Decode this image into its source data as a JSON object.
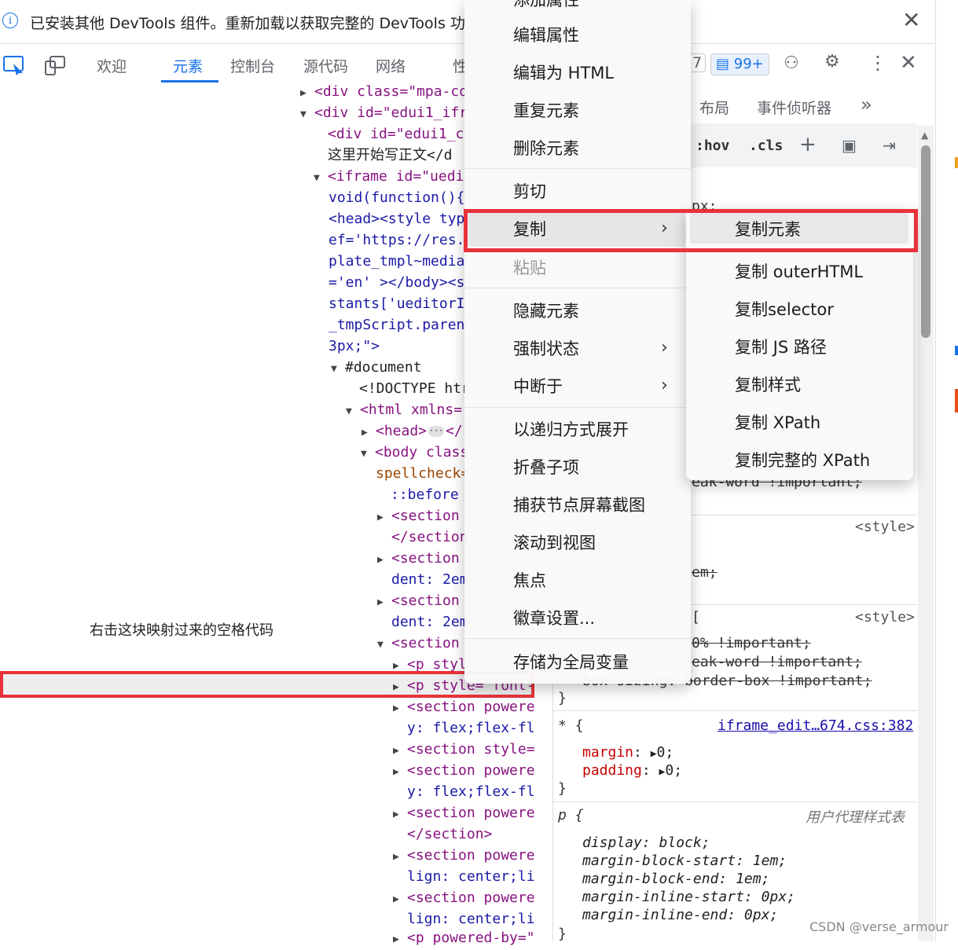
{
  "infobar": {
    "text": "已安装其他 DevTools 组件。重新加载以获取完整的 DevTools 功",
    "info_icon": "info-icon",
    "close_icon": "close-icon"
  },
  "toolbar": {
    "tabs": [
      "欢迎",
      "元素",
      "控制台",
      "源代码",
      "网络",
      "性"
    ],
    "active_tab": "元素",
    "badge_count": "7",
    "messages_badge": "99+",
    "accent_color": "#1a73e8"
  },
  "elements": {
    "lines": [
      {
        "text": "<div class=\"mpa-co"
      },
      {
        "text": "<div id=\"edui1_ifr"
      },
      {
        "text": "<div id=\"edui1_c"
      },
      {
        "text": "这里开始写正文</d"
      },
      {
        "text": "<iframe id=\"uedi"
      },
      {
        "text": "void(function(){"
      },
      {
        "text": "<head><style typ"
      },
      {
        "text": "ef='https://res."
      },
      {
        "text": "plate_tmpl~media"
      },
      {
        "text": "='en' ></body><s"
      },
      {
        "text": "stants['ueditorI"
      },
      {
        "text": "_tmpScript.paren"
      },
      {
        "text": "3px;\">"
      },
      {
        "text": "#document"
      },
      {
        "text": "<!DOCTYPE htr"
      },
      {
        "text": "<html xmlns="
      },
      {
        "text": "<head>"
      },
      {
        "text": "<body class"
      },
      {
        "text": "spellcheck="
      },
      {
        "text": "::before"
      },
      {
        "text": "<section"
      },
      {
        "text": "</section"
      },
      {
        "text": "<section"
      },
      {
        "text": "dent: 2em"
      },
      {
        "text": "<section"
      },
      {
        "text": "dent: 2em"
      },
      {
        "text": "<section"
      },
      {
        "text": "<p styl"
      },
      {
        "text": "<p style=\"font-"
      },
      {
        "text": "<section powere"
      },
      {
        "text": "y: flex;flex-fl"
      },
      {
        "text": "<section style="
      },
      {
        "text": "<section powere"
      },
      {
        "text": "y: flex;flex-fl"
      },
      {
        "text": "<section powere"
      },
      {
        "text": "</section>"
      },
      {
        "text": "<section powere"
      },
      {
        "text": "lign: center;li"
      },
      {
        "text": "<section powere"
      },
      {
        "text": "lign: center;li"
      },
      {
        "text": "<p powered-by=\""
      }
    ],
    "annotation": "右击这块映射过来的空格代码"
  },
  "styles": {
    "tabs": [
      "布局",
      "事件侦听器"
    ],
    "hov": ":hov",
    "cls": ".cls",
    "px_fragment": "px;",
    "break_word": "eak-word !important;",
    "style_tag_1": "<style>",
    "em_fragment": "em;",
    "bracket": "[",
    "style_tag_2": "<style>",
    "width_fragment": "0% !important;",
    "break_word_2": "eak-word !important;",
    "box_sizing": "box-sizing: border-box !important;",
    "close_brace_1": "}",
    "universal_selector": "* {",
    "universal_source": "iframe_edit…674.css:382",
    "margin_prop": "margin",
    "margin_value": "0;",
    "padding_prop": "padding",
    "padding_value": "0;",
    "close_brace_2": "}",
    "p_selector": "p {",
    "ua_label": "用户代理样式表",
    "ua_rules": [
      {
        "prop": "display",
        "value": "block;"
      },
      {
        "prop": "margin-block-start",
        "value": "1em;"
      },
      {
        "prop": "margin-block-end",
        "value": "1em;"
      },
      {
        "prop": "margin-inline-start",
        "value": "0px;"
      },
      {
        "prop": "margin-inline-end",
        "value": "0px;"
      }
    ],
    "close_brace_3": "}"
  },
  "context_menu": {
    "items": [
      {
        "label": "添加属性",
        "type": "item"
      },
      {
        "label": "编辑属性",
        "type": "item"
      },
      {
        "label": "编辑为 HTML",
        "type": "item"
      },
      {
        "label": "重复元素",
        "type": "item"
      },
      {
        "label": "删除元素",
        "type": "item"
      },
      {
        "label": "剪切",
        "type": "item"
      },
      {
        "label": "复制",
        "type": "submenu"
      },
      {
        "label": "粘贴",
        "type": "disabled"
      },
      {
        "label": "隐藏元素",
        "type": "item"
      },
      {
        "label": "强制状态",
        "type": "submenu"
      },
      {
        "label": "中断于",
        "type": "submenu"
      },
      {
        "label": "以递归方式展开",
        "type": "item"
      },
      {
        "label": "折叠子项",
        "type": "item"
      },
      {
        "label": "捕获节点屏幕截图",
        "type": "item"
      },
      {
        "label": "滚动到视图",
        "type": "item"
      },
      {
        "label": "焦点",
        "type": "item"
      },
      {
        "label": "徽章设置...",
        "type": "item"
      },
      {
        "label": "存储为全局变量",
        "type": "item"
      }
    ]
  },
  "copy_submenu": {
    "items": [
      "复制元素",
      "复制 outerHTML",
      "复制selector",
      "复制 JS 路径",
      "复制样式",
      "复制 XPath",
      "复制完整的 XPath"
    ]
  },
  "highlight_color": "#e8333a",
  "watermark": "CSDN @verse_armour"
}
